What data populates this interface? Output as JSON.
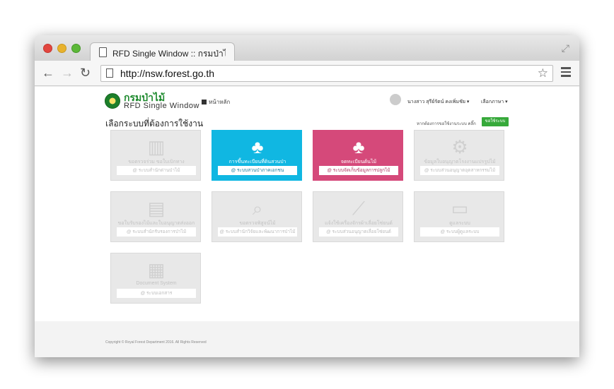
{
  "browser": {
    "tab_title": "RFD Single Window :: กรมป่าไม้",
    "url": "http://nsw.forest.go.th"
  },
  "site": {
    "logo_th": "กรมป่าไม้",
    "logo_en": "RFD Single Window",
    "home_link": "หน้าหลัก",
    "user_name": "นางสาว สุรีย์รัตน์ คงเพิ่มชัย ▾",
    "language": "เลือกภาษา ▾",
    "section_title": "เลือกระบบที่ต้องการใช้งาน",
    "register_text": "หากต้องการขอใช้งานระบบ คลิ๊ก",
    "register_button": "ขอใช้ระบบ",
    "copyright": "Copyright © Royal Forest Department 2016. All Rights Reserved"
  },
  "tiles": [
    {
      "name": "ขอตรวจร่วม ขอใบเบิกทาง",
      "sub": "@ ระบบสำนักด่านป่าไม้",
      "icon": "map-icon",
      "color": "grey"
    },
    {
      "name": "การขึ้นทะเบียนที่ดินสวนป่า",
      "sub": "@ ระบบสวนป่าภาคเอกชน",
      "icon": "tree-icon",
      "color": "#10b7e2"
    },
    {
      "name": "จดทะเบียนต้นไม้",
      "sub": "@ ระบบจัดเก็บข้อมูลการปลูกไม้",
      "icon": "tree-icon",
      "color": "#d5497a"
    },
    {
      "name": "ข้อมูลใบอนุญาตโรงงานแปรรูปไม้",
      "sub": "@ ระบบส่วนอนุญาตอุตสาหกรรมไม้",
      "icon": "gears-icon",
      "color": "grey"
    },
    {
      "name": "ขอใบรับรองไม้และใบอนุญาตส่งออก",
      "sub": "@ ระบบสำนักรับรองการป่าไม้",
      "icon": "certificate-icon",
      "color": "grey"
    },
    {
      "name": "ขอตรวจพิสูจน์ไม้",
      "sub": "@ ระบบสำนักวิจัยและพัฒนาการป่าไม้",
      "icon": "magnifier-icon",
      "color": "grey"
    },
    {
      "name": "แจ้งใช้เครื่องจักรผ้าเลื่อยโซ่ยนต์",
      "sub": "@ ระบบส่วนอนุญาตเลื่อยโซ่ยนต์",
      "icon": "chainsaw-icon",
      "color": "grey"
    },
    {
      "name": "ดูแลระบบ",
      "sub": "@ ระบบผู้ดูแลระบบ",
      "icon": "monitor-icon",
      "color": "grey"
    },
    {
      "name": "Document System",
      "sub": "@ ระบบเอกสาร",
      "icon": "archive-icon",
      "color": "grey"
    }
  ]
}
